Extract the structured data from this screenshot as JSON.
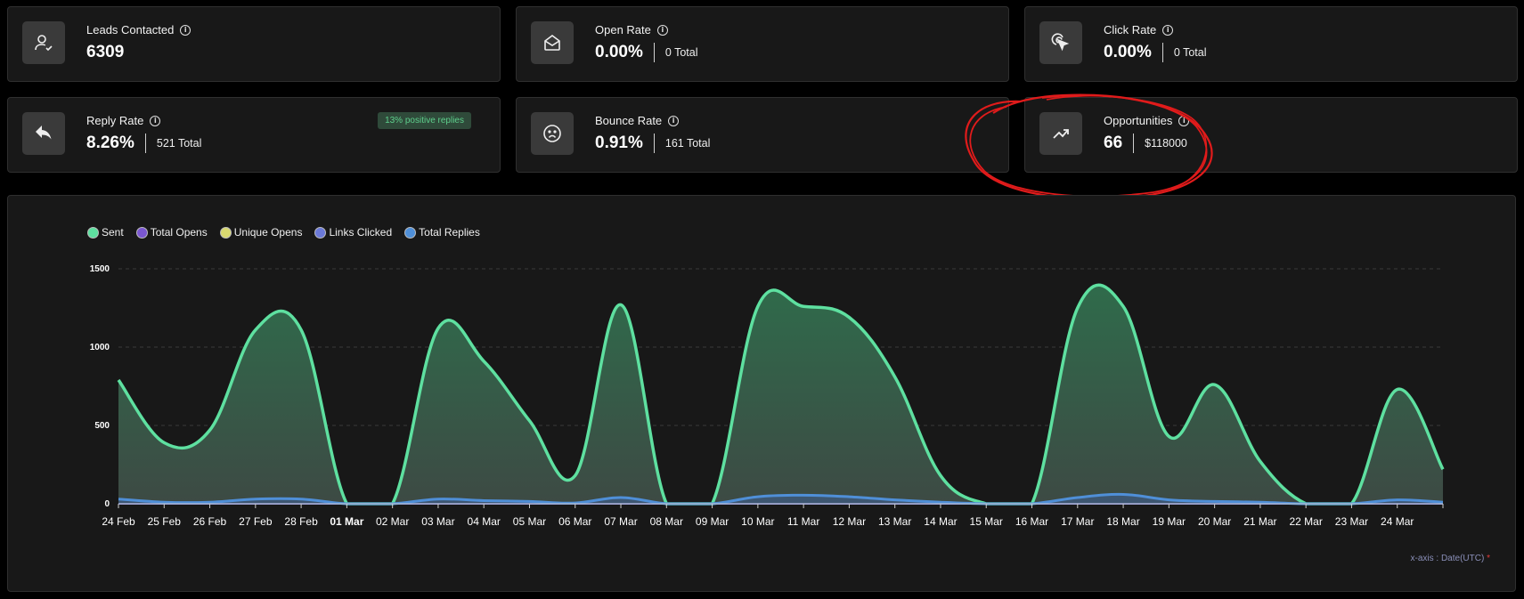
{
  "cards": {
    "leads": {
      "title": "Leads Contacted",
      "value": "6309",
      "icon": "user-check-icon"
    },
    "open": {
      "title": "Open Rate",
      "value": "0.00%",
      "total": "0 Total",
      "icon": "envelope-open-icon"
    },
    "click": {
      "title": "Click Rate",
      "value": "0.00%",
      "total": "0 Total",
      "icon": "cursor-click-icon"
    },
    "reply": {
      "title": "Reply Rate",
      "value": "8.26%",
      "total": "521 Total",
      "badge": "13% positive replies",
      "icon": "reply-arrow-icon"
    },
    "bounce": {
      "title": "Bounce Rate",
      "value": "0.91%",
      "total": "161 Total",
      "icon": "sad-face-icon"
    },
    "opportunities": {
      "title": "Opportunities",
      "value": "66",
      "total": "$118000",
      "icon": "trending-up-icon"
    }
  },
  "info_glyph": "i",
  "axis_note": {
    "text": "x-axis : Date(UTC)",
    "star": "*"
  },
  "colors": {
    "sent": "#5ee0a0",
    "total_opens": "#7a57d1",
    "unique_opens": "#d8d870",
    "links_clicked": "#6b79d8",
    "total_replies": "#4f8fd8",
    "annotation": "#e01b1b"
  },
  "chart_data": {
    "type": "area",
    "legend": [
      "Sent",
      "Total Opens",
      "Unique Opens",
      "Links Clicked",
      "Total Replies"
    ],
    "x": [
      "24 Feb",
      "25 Feb",
      "26 Feb",
      "27 Feb",
      "28 Feb",
      "01 Mar",
      "02 Mar",
      "03 Mar",
      "04 Mar",
      "05 Mar",
      "06 Mar",
      "07 Mar",
      "08 Mar",
      "09 Mar",
      "10 Mar",
      "11 Mar",
      "12 Mar",
      "13 Mar",
      "14 Mar",
      "15 Mar",
      "16 Mar",
      "17 Mar",
      "18 Mar",
      "19 Mar",
      "20 Mar",
      "21 Mar",
      "22 Mar",
      "23 Mar",
      "24 Mar",
      ""
    ],
    "bold_tick": "01 Mar",
    "yticks": [
      "0",
      "500",
      "1000",
      "1500"
    ],
    "ylim": [
      0,
      1500
    ],
    "series": [
      {
        "name": "Sent",
        "values": [
          790,
          390,
          470,
          1110,
          1110,
          0,
          0,
          1120,
          910,
          530,
          180,
          1270,
          0,
          0,
          1260,
          1260,
          1190,
          810,
          180,
          0,
          0,
          1250,
          1260,
          430,
          760,
          270,
          0,
          0,
          730,
          220
        ]
      },
      {
        "name": "Total Opens",
        "values": [
          0,
          0,
          0,
          0,
          0,
          0,
          0,
          0,
          0,
          0,
          0,
          0,
          0,
          0,
          0,
          0,
          0,
          0,
          0,
          0,
          0,
          0,
          0,
          0,
          0,
          0,
          0,
          0,
          0,
          0
        ]
      },
      {
        "name": "Unique Opens",
        "values": [
          0,
          0,
          0,
          0,
          0,
          0,
          0,
          0,
          0,
          0,
          0,
          0,
          0,
          0,
          0,
          0,
          0,
          0,
          0,
          0,
          0,
          0,
          0,
          0,
          0,
          0,
          0,
          0,
          0,
          0
        ]
      },
      {
        "name": "Links Clicked",
        "values": [
          0,
          0,
          0,
          0,
          0,
          0,
          0,
          0,
          0,
          0,
          0,
          0,
          0,
          0,
          0,
          0,
          0,
          0,
          0,
          0,
          0,
          0,
          0,
          0,
          0,
          0,
          0,
          0,
          0,
          0
        ]
      },
      {
        "name": "Total Replies",
        "values": [
          30,
          10,
          10,
          30,
          30,
          0,
          0,
          30,
          20,
          15,
          5,
          40,
          0,
          0,
          45,
          55,
          45,
          25,
          10,
          0,
          0,
          40,
          60,
          25,
          15,
          10,
          0,
          0,
          25,
          10
        ]
      }
    ],
    "grid": true,
    "legend_position": "top-left"
  }
}
